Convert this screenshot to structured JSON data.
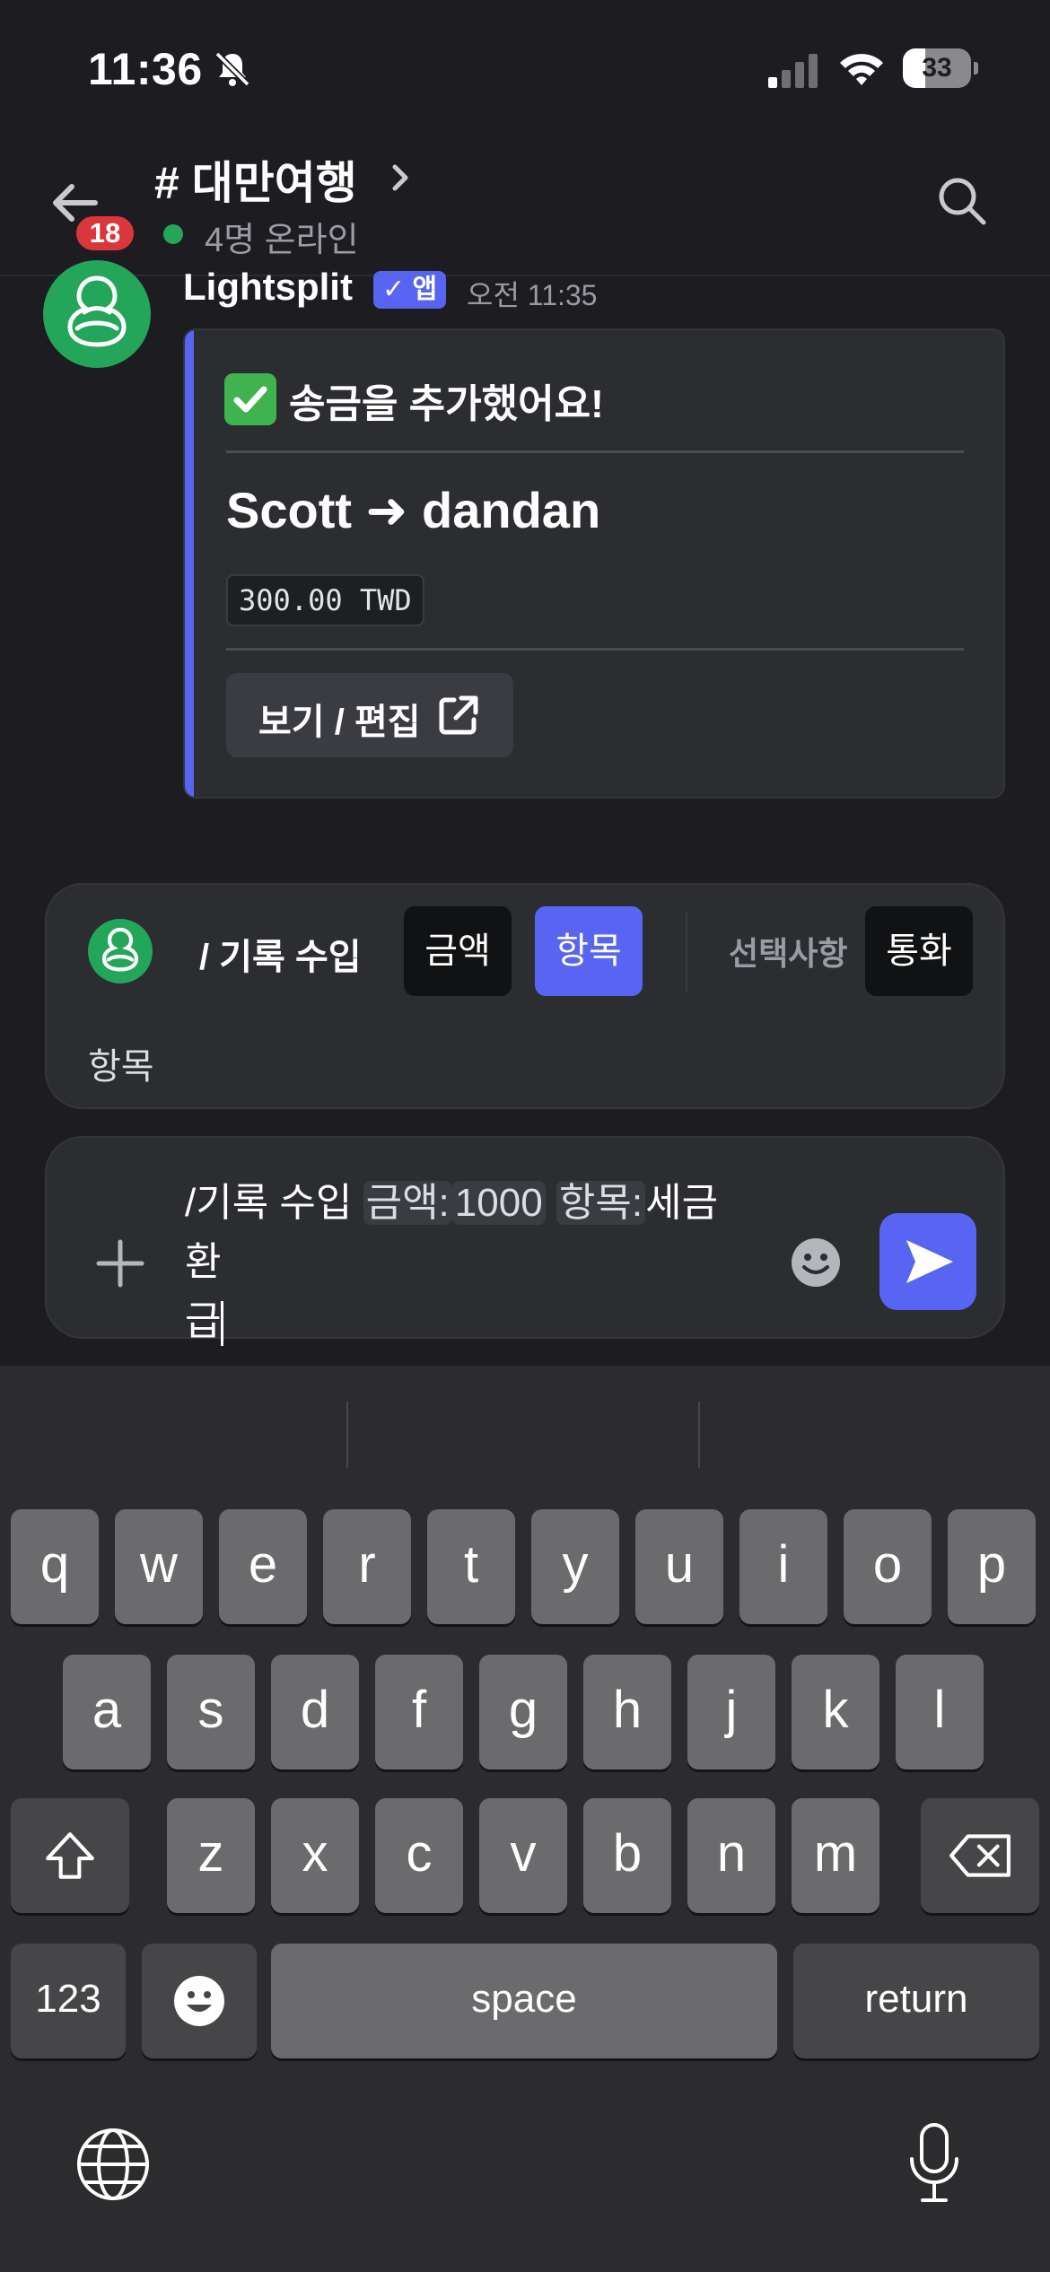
{
  "status_bar": {
    "time": "11:36",
    "battery": "33",
    "battery_level": 0.33,
    "silent_icon": "bell-slash-icon"
  },
  "header": {
    "badge": "18",
    "channel": "# 대만여행",
    "online": "4명 온라인"
  },
  "message": {
    "author": "Lightsplit",
    "app_tag": "✓ 앱",
    "time": "오전 11:35",
    "embed": {
      "title": "송금을 추가했어요!",
      "transfer": "Scott ➜ dandan",
      "amount": "300.00 TWD",
      "button": "보기 / 편집"
    }
  },
  "command": {
    "name": "/ 기록 수입",
    "chips": {
      "amount": "금액",
      "item": "항목",
      "optional": "선택사항",
      "currency": "통화"
    },
    "description": "항목"
  },
  "input": {
    "prefix": "/기록 수입 ",
    "amount_key": "금액:",
    "amount_value": "1000",
    "item_key": "항목:",
    "item_value_line1": "세금 환",
    "item_value_line2": "급"
  },
  "keyboard": {
    "row1": [
      "q",
      "w",
      "e",
      "r",
      "t",
      "y",
      "u",
      "i",
      "o",
      "p"
    ],
    "row2": [
      "a",
      "s",
      "d",
      "f",
      "g",
      "h",
      "j",
      "k",
      "l"
    ],
    "row3": [
      "z",
      "x",
      "c",
      "v",
      "b",
      "n",
      "m"
    ],
    "numbers": "123",
    "space": "space",
    "return": "return"
  },
  "colors": {
    "accent": "#5865f2",
    "green": "#23a55a",
    "badge": "#da373c",
    "background": "#1c1c21"
  }
}
